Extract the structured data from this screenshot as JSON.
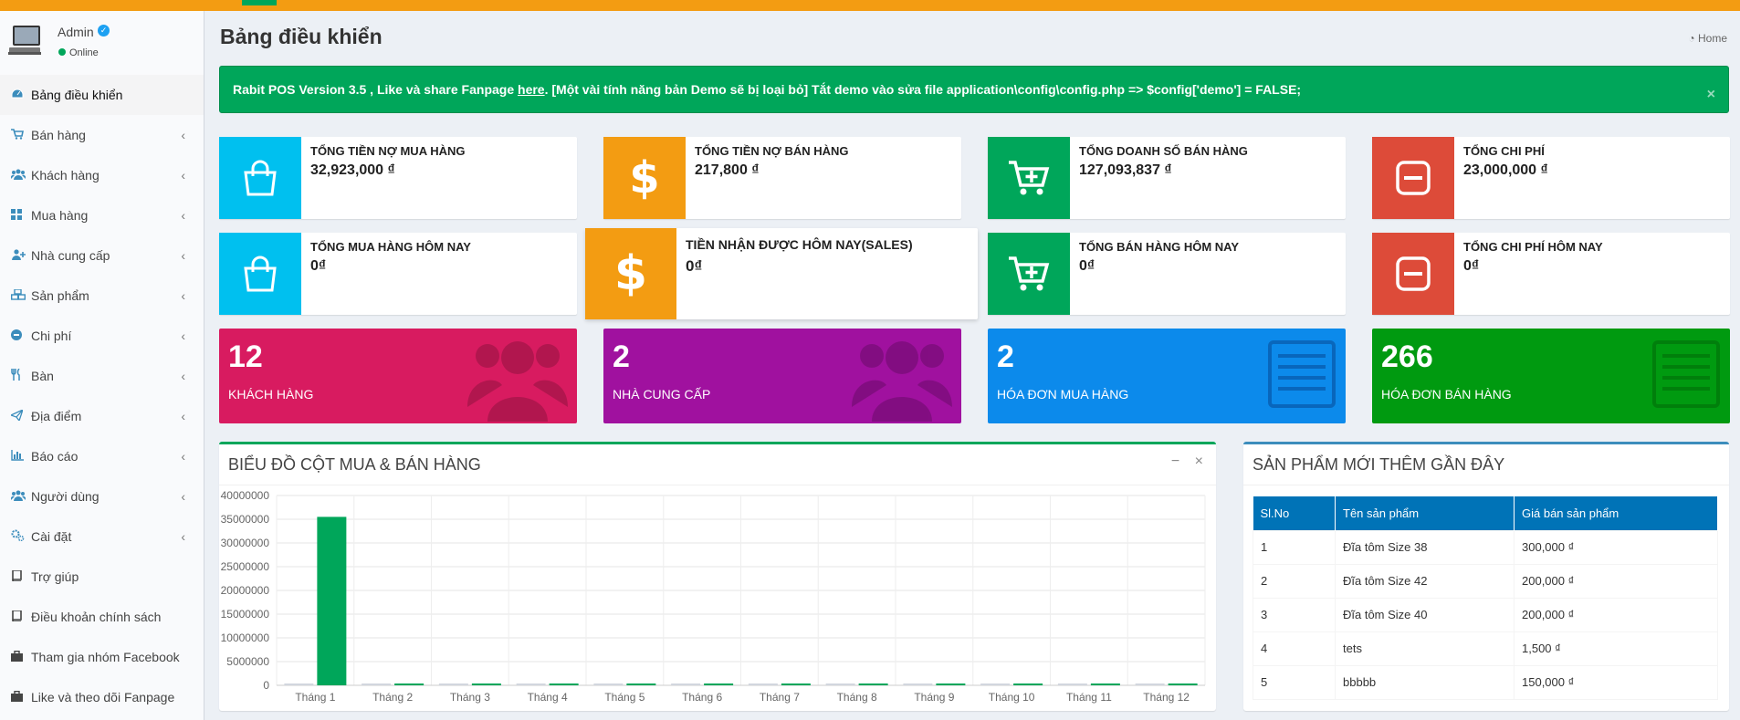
{
  "colors": {
    "aqua": "#00c0ef",
    "yellow": "#f39c12",
    "green": "#00a65a",
    "red": "#dd4b39",
    "maroon": "#d81b60",
    "purple": "#a0119f",
    "blue": "#0c8aeb",
    "dark_green": "#009a10"
  },
  "user": {
    "name": "Admin",
    "status": "Online"
  },
  "sidebar": {
    "items": [
      {
        "label": "Bảng điều khiển",
        "icon": "dashboard-icon",
        "active": true
      },
      {
        "label": "Bán hàng",
        "icon": "cart-icon"
      },
      {
        "label": "Khách hàng",
        "icon": "users-icon"
      },
      {
        "label": "Mua hàng",
        "icon": "grid-icon"
      },
      {
        "label": "Nhà cung cấp",
        "icon": "user-plus-icon"
      },
      {
        "label": "Sản phẩm",
        "icon": "cubes-icon"
      },
      {
        "label": "Chi phí",
        "icon": "minus-circle-icon"
      },
      {
        "label": "Bàn",
        "icon": "cutlery-icon"
      },
      {
        "label": "Địa điểm",
        "icon": "paper-plane-icon"
      },
      {
        "label": "Báo cáo",
        "icon": "bar-chart-icon"
      },
      {
        "label": "Người dùng",
        "icon": "users-icon"
      },
      {
        "label": "Cài đặt",
        "icon": "cogs-icon"
      },
      {
        "label": "Trợ giúp",
        "icon": "book-icon"
      },
      {
        "label": "Điều khoản chính sách",
        "icon": "book-icon"
      },
      {
        "label": "Tham gia nhóm Facebook",
        "icon": "briefcase-icon"
      },
      {
        "label": "Like và theo dõi Fanpage",
        "icon": "briefcase-icon"
      }
    ]
  },
  "header": {
    "title": "Bảng điều khiển",
    "breadcrumb": "Home"
  },
  "alert": {
    "text_before": "Rabit POS Version 3.5 , Like và share Fanpage ",
    "link": "here",
    "text_after": ". [Một vài tính năng bản Demo sẽ bị loại bỏ] Tắt demo vào sửa file application\\config\\config.php => $config['demo'] = FALSE;",
    "close": "×"
  },
  "info_boxes": [
    {
      "label": "Tổng tiền nợ mua hàng",
      "value": "32,923,000 ₫",
      "icon": "shopping-bag-icon",
      "color": "aqua"
    },
    {
      "label": "Tổng tiền nợ bán hàng",
      "value": "217,800 ₫",
      "icon": "dollar-icon",
      "color": "yellow"
    },
    {
      "label": "Tổng doanh số bán hàng",
      "value": "127,093,837 ₫",
      "icon": "cart-plus-icon",
      "color": "green"
    },
    {
      "label": "Tổng chi phí",
      "value": "23,000,000 ₫",
      "icon": "minus-square-icon",
      "color": "red"
    },
    {
      "label": "Tổng mua hàng hôm nay",
      "value": "0₫",
      "icon": "shopping-bag-icon",
      "color": "aqua"
    },
    {
      "label": "Tiền nhận được hôm nay(sales)",
      "value": "0₫",
      "icon": "dollar-icon",
      "color": "yellow"
    },
    {
      "label": "Tổng bán hàng hôm nay",
      "value": "0₫",
      "icon": "cart-plus-icon",
      "color": "green"
    },
    {
      "label": "Tổng chi phí hôm nay",
      "value": "0₫",
      "icon": "minus-square-icon",
      "color": "red"
    }
  ],
  "small_boxes": [
    {
      "number": "12",
      "label": "KHÁCH HÀNG",
      "icon": "users-icon",
      "color": "maroon"
    },
    {
      "number": "2",
      "label": "NHÀ CUNG CẤP",
      "icon": "users-icon",
      "color": "purple"
    },
    {
      "number": "2",
      "label": "HÓA ĐƠN MUA HÀNG",
      "icon": "list-alt-icon",
      "color": "blue"
    },
    {
      "number": "266",
      "label": "HÓA ĐƠN BÁN HÀNG",
      "icon": "list-alt-icon",
      "color": "dark_green"
    }
  ],
  "chart_box": {
    "title": "BIỂU ĐỒ CỘT MUA & BÁN HÀNG",
    "minimize": "−",
    "close": "×"
  },
  "chart_data": {
    "type": "bar",
    "categories": [
      "Tháng 1",
      "Tháng 2",
      "Tháng 3",
      "Tháng 4",
      "Tháng 5",
      "Tháng 6",
      "Tháng 7",
      "Tháng 8",
      "Tháng 9",
      "Tháng 10",
      "Tháng 11",
      "Tháng 12"
    ],
    "series": [
      {
        "values": [
          0,
          0,
          0,
          0,
          0,
          0,
          0,
          0,
          0,
          0,
          0,
          0
        ],
        "color": "#d2d6de"
      },
      {
        "values": [
          35500000,
          0,
          0,
          0,
          0,
          0,
          0,
          0,
          0,
          0,
          0,
          0
        ],
        "color": "#00a65a"
      }
    ],
    "yticks": [
      "0",
      "5000000",
      "10000000",
      "15000000",
      "20000000",
      "25000000",
      "30000000",
      "35000000",
      "40000000"
    ],
    "ylim": [
      0,
      40000000
    ],
    "grid": true
  },
  "products_box": {
    "title": "SẢN PHẨM MỚI THÊM GẦN ĐÂY",
    "columns": [
      "Sl.No",
      "Tên sản phẩm",
      "Giá bán sản phẩm"
    ],
    "rows": [
      [
        "1",
        "Đĩa tôm Size 38",
        "300,000 ₫"
      ],
      [
        "2",
        "Đĩa tôm Size 42",
        "200,000 ₫"
      ],
      [
        "3",
        "Đĩa tôm Size 40",
        "200,000 ₫"
      ],
      [
        "4",
        "tets",
        "1,500 ₫"
      ],
      [
        "5",
        "bbbbb",
        "150,000 ₫"
      ]
    ]
  }
}
